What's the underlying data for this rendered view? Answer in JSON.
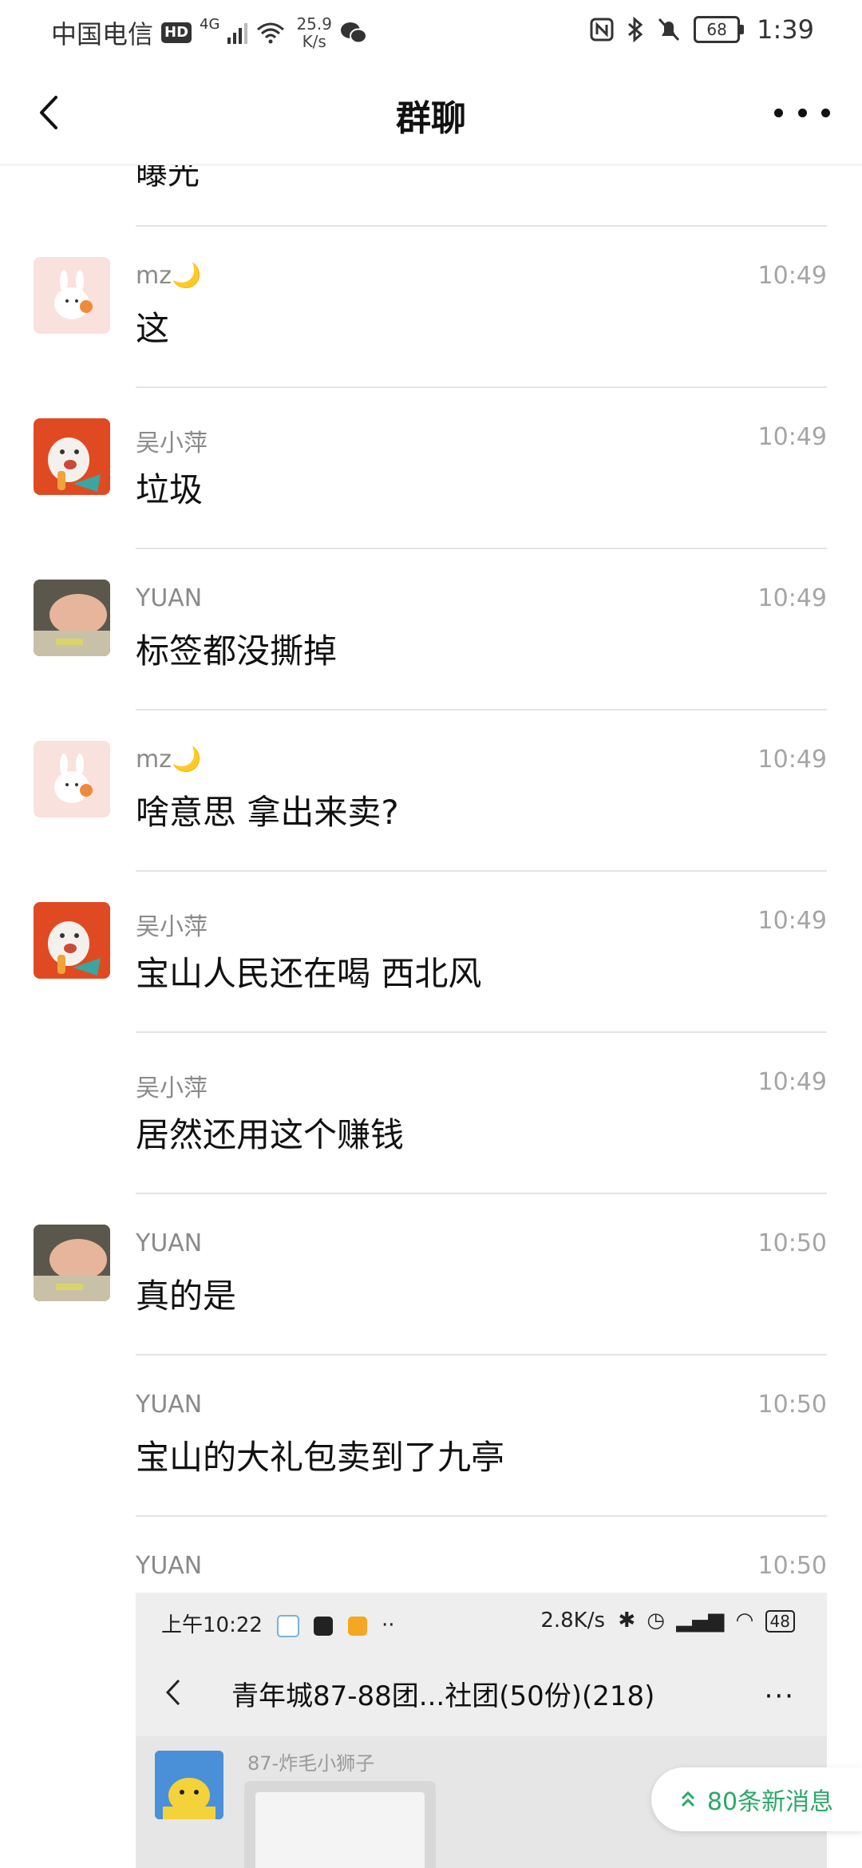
{
  "status_bar": {
    "carrier": "中国电信",
    "hd_badge": "HD",
    "network": "4G",
    "speed_value": "25.9",
    "speed_unit": "K/s",
    "battery": "68",
    "time": "1:39"
  },
  "header": {
    "title": "群聊"
  },
  "partial_message": "曝光",
  "messages": [
    {
      "name": "mz🌙",
      "time": "10:49",
      "text": "这",
      "avatar": "rabbit-avatar"
    },
    {
      "name": "吴小萍",
      "time": "10:49",
      "text": "垃圾",
      "avatar": "cat-avatar"
    },
    {
      "name": "YUAN",
      "time": "10:49",
      "text": "标签都没撕掉",
      "avatar": "yuan-avatar"
    },
    {
      "name": "mz🌙",
      "time": "10:49",
      "text": "啥意思 拿出来卖?",
      "avatar": "rabbit-avatar"
    },
    {
      "name": "吴小萍",
      "time": "10:49",
      "text": "宝山人民还在喝 西北风",
      "avatar": "cat-avatar"
    },
    {
      "name": "吴小萍",
      "time": "10:49",
      "text": "居然还用这个赚钱",
      "avatar": ""
    },
    {
      "name": "YUAN",
      "time": "10:50",
      "text": "真的是",
      "avatar": "yuan-avatar"
    },
    {
      "name": "YUAN",
      "time": "10:50",
      "text": "宝山的大礼包卖到了九亭",
      "avatar": ""
    },
    {
      "name": "YUAN",
      "time": "10:50",
      "text": "",
      "avatar": ""
    }
  ],
  "screenshot_message": {
    "status_time": "上午10:22",
    "status_speed": "2.8K/s",
    "battery": "48",
    "title": "青年城87-88团...社团(50份)(218)",
    "more": "···",
    "sender": "87-炸毛小狮子"
  },
  "new_messages_pill": {
    "label": "80条新消息",
    "color": "#2ca76a"
  }
}
